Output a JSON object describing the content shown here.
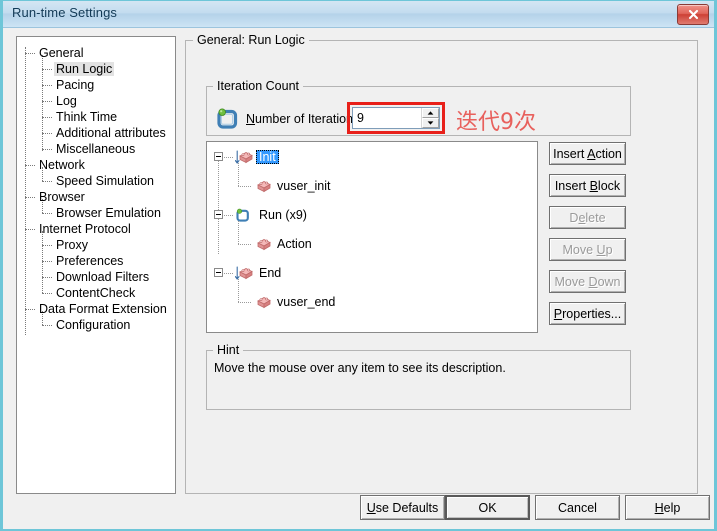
{
  "window": {
    "title": "Run-time Settings",
    "close_icon": "close-icon"
  },
  "nav": {
    "items": [
      {
        "label": "General",
        "level": 0,
        "selected": false
      },
      {
        "label": "Run Logic",
        "level": 1,
        "selected": true
      },
      {
        "label": "Pacing",
        "level": 1,
        "selected": false
      },
      {
        "label": "Log",
        "level": 1,
        "selected": false
      },
      {
        "label": "Think Time",
        "level": 1,
        "selected": false
      },
      {
        "label": "Additional attributes",
        "level": 1,
        "selected": false
      },
      {
        "label": "Miscellaneous",
        "level": 1,
        "selected": false
      },
      {
        "label": "Network",
        "level": 0,
        "selected": false
      },
      {
        "label": "Speed Simulation",
        "level": 1,
        "selected": false
      },
      {
        "label": "Browser",
        "level": 0,
        "selected": false
      },
      {
        "label": "Browser Emulation",
        "level": 1,
        "selected": false
      },
      {
        "label": "Internet Protocol",
        "level": 0,
        "selected": false
      },
      {
        "label": "Proxy",
        "level": 1,
        "selected": false
      },
      {
        "label": "Preferences",
        "level": 1,
        "selected": false
      },
      {
        "label": "Download Filters",
        "level": 1,
        "selected": false
      },
      {
        "label": "ContentCheck",
        "level": 1,
        "selected": false
      },
      {
        "label": "Data Format Extension",
        "level": 0,
        "selected": false
      },
      {
        "label": "Configuration",
        "level": 1,
        "selected": false
      }
    ]
  },
  "content": {
    "group_title": "General: Run Logic",
    "iteration": {
      "group_title": "Iteration Count",
      "icon": "loop-icon",
      "label_prefix": "N",
      "label_rest": "umber of Iterations:",
      "value": "9",
      "placeholder": "",
      "annotation": "迭代9次",
      "annotation_color": "#e8605c",
      "highlight_color": "#e8201a"
    },
    "runlogic": {
      "nodes": [
        {
          "label": "Init",
          "icon": "block-arrow-icon",
          "indent": 0,
          "selected": true
        },
        {
          "label": "vuser_init",
          "icon": "block-icon",
          "indent": 1,
          "selected": false
        },
        {
          "label": "Run (x9)",
          "icon": "loop-icon",
          "indent": 0,
          "selected": false
        },
        {
          "label": "Action",
          "icon": "block-icon",
          "indent": 1,
          "selected": false
        },
        {
          "label": "End",
          "icon": "block-arrow-icon",
          "indent": 0,
          "selected": false
        },
        {
          "label": "vuser_end",
          "icon": "block-icon",
          "indent": 1,
          "selected": false
        }
      ]
    },
    "side_buttons": [
      {
        "pre": "Insert ",
        "accel": "A",
        "post": "ction",
        "disabled": false
      },
      {
        "pre": "Insert ",
        "accel": "B",
        "post": "lock",
        "disabled": false
      },
      {
        "pre": "D",
        "accel": "e",
        "post": "lete",
        "disabled": true
      },
      {
        "pre": "Move ",
        "accel": "U",
        "post": "p",
        "disabled": true
      },
      {
        "pre": "Move ",
        "accel": "D",
        "post": "own",
        "disabled": true
      },
      {
        "pre": "",
        "accel": "P",
        "post": "roperties...",
        "disabled": false
      }
    ],
    "hint": {
      "group_title": "Hint",
      "text": "Move the mouse over any item to see its description."
    }
  },
  "footer": {
    "buttons": [
      {
        "pre": "",
        "accel": "U",
        "post": "se Defaults",
        "default": false
      },
      {
        "pre": "OK",
        "accel": "",
        "post": "",
        "default": true
      },
      {
        "pre": "Cancel",
        "accel": "",
        "post": "",
        "default": false
      },
      {
        "pre": "",
        "accel": "H",
        "post": "elp",
        "default": false
      }
    ]
  }
}
